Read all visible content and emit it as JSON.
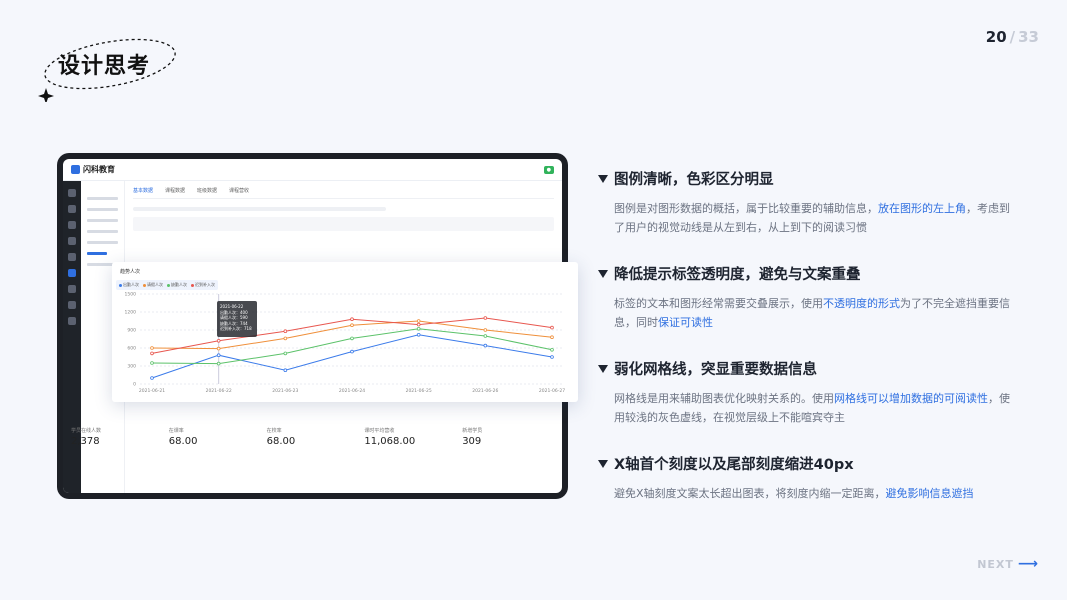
{
  "title": "设计思考",
  "page": {
    "current": "20",
    "separator": "/",
    "total": "33"
  },
  "next_label": "NEXT",
  "mock": {
    "logo": "闪科教育",
    "tabs": [
      "基本数据",
      "课程数据",
      "班级数据",
      "课程营收"
    ],
    "stats": [
      {
        "label": "学员在线人数",
        "value": "2,378"
      },
      {
        "label": "在课率",
        "value": "68.00"
      },
      {
        "label": "在校率",
        "value": "68.00"
      },
      {
        "label": "课时平均营收",
        "value": "11,068.00"
      },
      {
        "label": "新增学员",
        "value": "309"
      }
    ],
    "chart_title": "趋势人次",
    "legend": [
      {
        "name": "出勤人次",
        "color": "#3b7bea"
      },
      {
        "name": "请假人次",
        "color": "#ef8f3a"
      },
      {
        "name": "缺勤人次",
        "color": "#5cc26a"
      },
      {
        "name": "迟到补入次",
        "color": "#e8574f"
      }
    ],
    "tooltip": {
      "date": "2021-06-22",
      "rows": [
        "出勤人次：400",
        "请假人次：590",
        "缺勤人次：744",
        "迟到补入次：718"
      ]
    }
  },
  "chart_data": {
    "type": "line",
    "x": [
      "2021-06-21",
      "2021-06-22",
      "2021-06-23",
      "2021-06-24",
      "2021-06-25",
      "2021-06-26",
      "2021-06-27"
    ],
    "yticks": [
      "0",
      "300",
      "600",
      "900",
      "1200",
      "1500"
    ],
    "ylim": [
      0,
      1500
    ],
    "series": [
      {
        "name": "出勤人次",
        "color": "#3b7bea",
        "values": [
          100,
          480,
          230,
          540,
          820,
          640,
          450
        ]
      },
      {
        "name": "请假人次",
        "color": "#ef8f3a",
        "values": [
          600,
          590,
          760,
          980,
          1050,
          900,
          780
        ]
      },
      {
        "name": "缺勤人次",
        "color": "#5cc26a",
        "values": [
          350,
          340,
          510,
          760,
          920,
          800,
          570
        ]
      },
      {
        "name": "迟到补入次",
        "color": "#e8574f",
        "values": [
          510,
          720,
          880,
          1080,
          990,
          1100,
          940
        ]
      }
    ]
  },
  "points": [
    {
      "heading": "图例清晰，色彩区分明显",
      "body": [
        {
          "t": "图例是对图形数据的概括，属于比较重要的辅助信息，"
        },
        {
          "t": "放在图形的左上角",
          "hl": true
        },
        {
          "t": "，考虑到了用户的视觉动线是从左到右，从上到下的阅读习惯"
        }
      ]
    },
    {
      "heading": "降低提示标签透明度，避免与文案重叠",
      "body": [
        {
          "t": "标签的文本和图形经常需要交叠展示，使用"
        },
        {
          "t": "不透明度的形式",
          "hl": true
        },
        {
          "t": "为了不完全遮挡重要信息，同时"
        },
        {
          "t": "保证可读性",
          "hl": true
        }
      ]
    },
    {
      "heading": "弱化网格线，突显重要数据信息",
      "body": [
        {
          "t": "网格线是用来辅助图表优化映射关系的。使用"
        },
        {
          "t": "网格线可以增加数据的可阅读性",
          "hl": true
        },
        {
          "t": "，使用较浅的灰色虚线，在视觉层级上不能喧宾夺主"
        }
      ]
    },
    {
      "heading": "X轴首个刻度以及尾部刻度缩进40px",
      "body": [
        {
          "t": "避免X轴刻度文案太长超出图表，将刻度内缩一定距离，"
        },
        {
          "t": "避免影响信息遮挡",
          "hl": true
        }
      ]
    }
  ]
}
